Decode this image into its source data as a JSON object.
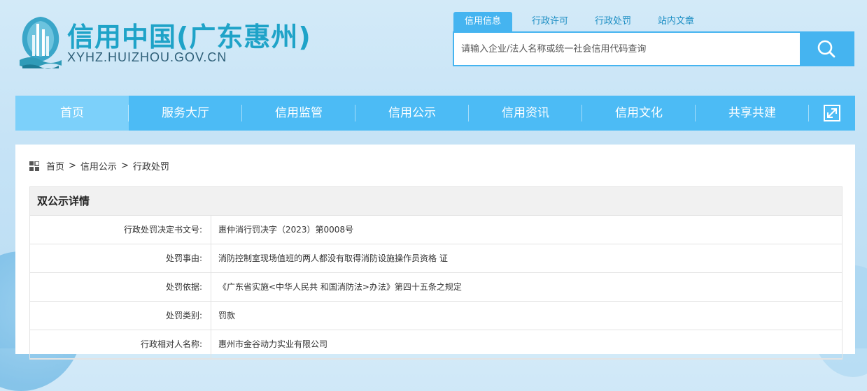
{
  "header": {
    "site_title": "信用中国(广东惠州)",
    "site_domain": "XYHZ.HUIZHOU.GOV.CN",
    "logo_icon": "city-logo-icon"
  },
  "search": {
    "tabs": [
      {
        "label": "信用信息",
        "active": true
      },
      {
        "label": "行政许可",
        "active": false
      },
      {
        "label": "行政处罚",
        "active": false
      },
      {
        "label": "站内文章",
        "active": false
      }
    ],
    "placeholder": "请输入企业/法人名称或统一社会信用代码查询",
    "button_icon": "search-icon"
  },
  "nav": {
    "items": [
      {
        "label": "首页",
        "active": true
      },
      {
        "label": "服务大厅"
      },
      {
        "label": "信用监管"
      },
      {
        "label": "信用公示"
      },
      {
        "label": "信用资讯"
      },
      {
        "label": "信用文化"
      },
      {
        "label": "共享共建"
      }
    ],
    "expand_icon": "fullscreen-icon"
  },
  "breadcrumb": {
    "icon": "grid-icon",
    "items": [
      "首页",
      "信用公示",
      "行政处罚"
    ],
    "separator": ">"
  },
  "detail": {
    "title": "双公示详情",
    "rows": [
      {
        "label": "行政处罚决定书文号:",
        "value": "惠仲消行罚决字（2023）第0008号"
      },
      {
        "label": "处罚事由:",
        "value": "消防控制室现场值班的两人都没有取得消防设施操作员资格 证"
      },
      {
        "label": "处罚依据:",
        "value": "《广东省实施<中华人民共 和国消防法>办法》第四十五条之规定"
      },
      {
        "label": "处罚类别:",
        "value": "罚款"
      },
      {
        "label": "行政相对人名称:",
        "value": "惠州市金谷动力实业有限公司"
      }
    ]
  },
  "colors": {
    "accent": "#45b4f0",
    "nav_bg": "#4cbbf5",
    "nav_active": "#7cd0fa",
    "title": "#1fa3c8"
  }
}
